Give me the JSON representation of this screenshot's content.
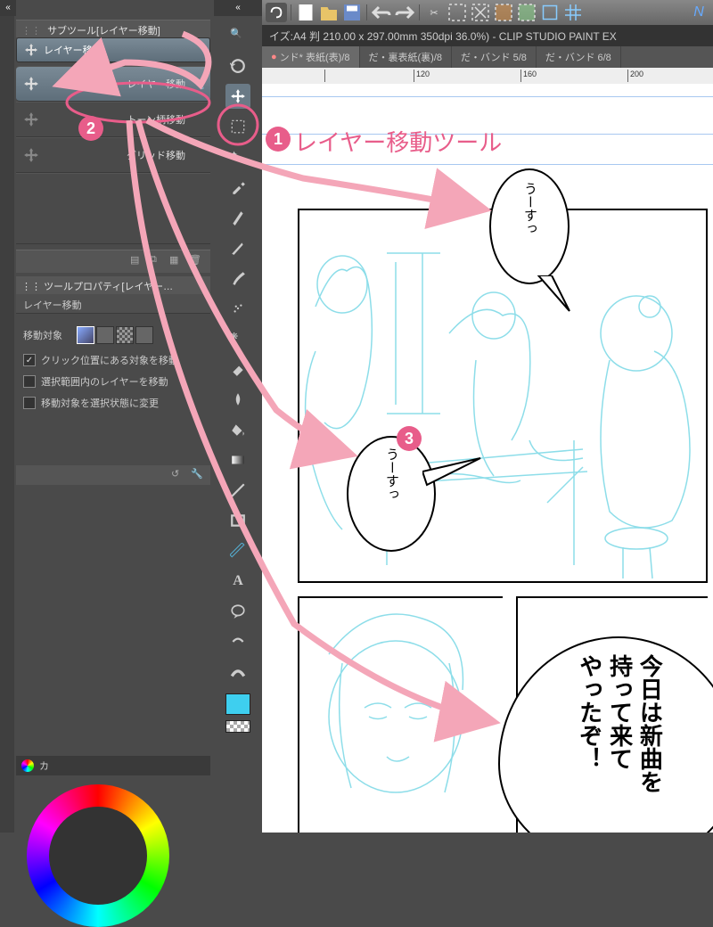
{
  "subtool": {
    "header": "サブツール[レイヤー移動]",
    "tab": "レイヤー移動",
    "items": [
      {
        "label": "レイヤー移動",
        "active": true
      },
      {
        "label": "トーン柄移動",
        "active": false
      },
      {
        "label": "グリッド移動",
        "active": false
      }
    ]
  },
  "property": {
    "header": "ツールプロパティ[レイヤー…",
    "title": "レイヤー移動",
    "target_label": "移動対象",
    "checks": [
      {
        "label": "クリック位置にある対象を移動",
        "checked": true
      },
      {
        "label": "選択範囲内のレイヤーを移動",
        "checked": false
      },
      {
        "label": "移動対象を選択状態に変更",
        "checked": false
      }
    ]
  },
  "color_panel": {
    "label": "カ"
  },
  "title_bar": "イズ:A4 判 210.00 x 297.00mm 350dpi 36.0%)  -  CLIP STUDIO PAINT EX",
  "tabs": [
    {
      "label": "ンド* 表紙(表)/8",
      "active": true
    },
    {
      "label": "だ・裏表紙(裏)/8",
      "active": false
    },
    {
      "label": "だ・バンド  5/8",
      "active": false
    },
    {
      "label": "だ・バンド  6/8",
      "active": false
    }
  ],
  "ruler_ticks": [
    {
      "pos": 30,
      "val": ""
    },
    {
      "pos": 120,
      "val": "120"
    },
    {
      "pos": 240,
      "val": "160"
    },
    {
      "pos": 360,
      "val": "200"
    }
  ],
  "balloons": {
    "b1": "うーすっ",
    "b2": "うーすっ",
    "b3": "今日は新曲を\n持って来て\nやったぞ！"
  },
  "annotations": {
    "n1": "1",
    "n1_text": "レイヤー移動ツール",
    "n2": "2",
    "n3": "3"
  },
  "tool_icons": [
    "magnifier",
    "hand",
    "move",
    "lasso",
    "crop",
    "wand",
    "eyedrop",
    "pen",
    "pencil",
    "brush",
    "airbrush",
    "blob",
    "blur",
    "eraser",
    "blend",
    "fill",
    "gradient",
    "shape",
    "frame",
    "ruler",
    "text",
    "balloon",
    "line",
    "correct"
  ]
}
